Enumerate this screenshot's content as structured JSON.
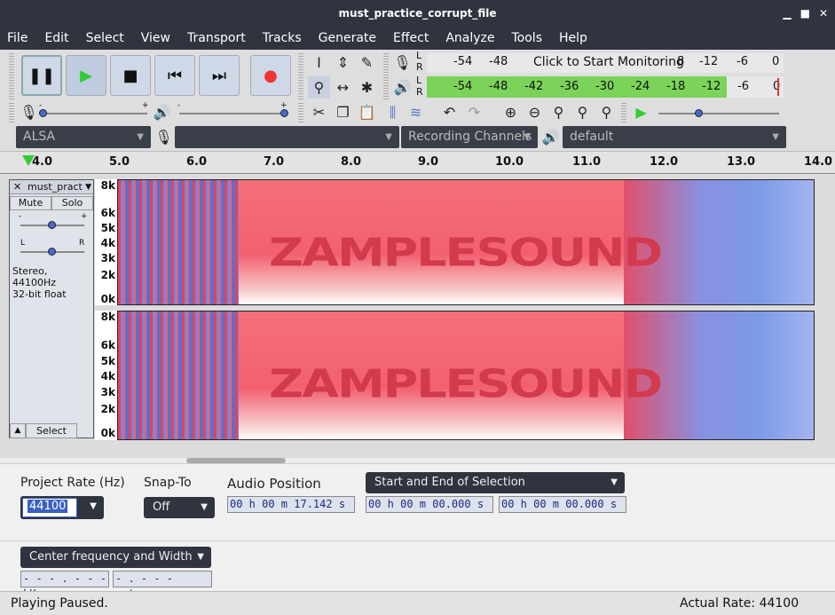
{
  "window": {
    "title": "must_practice_corrupt_file"
  },
  "menu": [
    "File",
    "Edit",
    "Select",
    "View",
    "Transport",
    "Tracks",
    "Generate",
    "Effect",
    "Analyze",
    "Tools",
    "Help"
  ],
  "meter": {
    "record_ticks": [
      "-54",
      "-48"
    ],
    "monitor_prompt": "Click to Start Monitoring",
    "record_ticks_right": [
      "8",
      "-12",
      "-6",
      "0"
    ],
    "play_ticks": [
      "-54",
      "-48",
      "-42",
      "-36",
      "-30",
      "-24",
      "-18",
      "-12",
      "-6",
      "0"
    ],
    "playback_level": 0.84,
    "lr": [
      "L",
      "R"
    ]
  },
  "device": {
    "host": "ALSA",
    "rec_device": "",
    "channels": "Recording Channels",
    "play_device": "default"
  },
  "ruler": {
    "ticks": [
      "4.0",
      "5.0",
      "6.0",
      "7.0",
      "8.0",
      "9.0",
      "10.0",
      "11.0",
      "12.0",
      "13.0",
      "14.0"
    ]
  },
  "track": {
    "name": "must_practi",
    "mute": "Mute",
    "solo": "Solo",
    "gain_minus": "-",
    "gain_plus": "+",
    "pan_left": "L",
    "pan_right": "R",
    "info_line1": "Stereo, 44100Hz",
    "info_line2": "32-bit float",
    "select": "Select",
    "yaxis": [
      "8k",
      "6k",
      "5k",
      "4k",
      "3k",
      "2k",
      "0k"
    ],
    "watermark": "ZAMPLESOUND"
  },
  "bottom": {
    "project_rate_label": "Project Rate (Hz)",
    "project_rate": "44100",
    "snap_label": "Snap-To",
    "snap_value": "Off",
    "audio_pos_label": "Audio Position",
    "audio_pos": "00 h 00 m 17.142 s",
    "selection_mode": "Start and End of Selection",
    "sel_start": "00 h 00 m 00.000 s",
    "sel_end": "00 h 00 m 00.000 s",
    "spectral_mode": "Center frequency and Width",
    "freq_value": "- - - . - - -",
    "freq_unit": "kHz",
    "width_value": "- . - - -",
    "width_unit": "octaves"
  },
  "status": {
    "left": "Playing Paused.",
    "right": "Actual Rate: 44100"
  },
  "colors": {
    "title_bg": "#2f343f",
    "spec_hot": "#f05060",
    "spec_cold": "#6a8ce0",
    "meter_green": "#7cd35a"
  }
}
